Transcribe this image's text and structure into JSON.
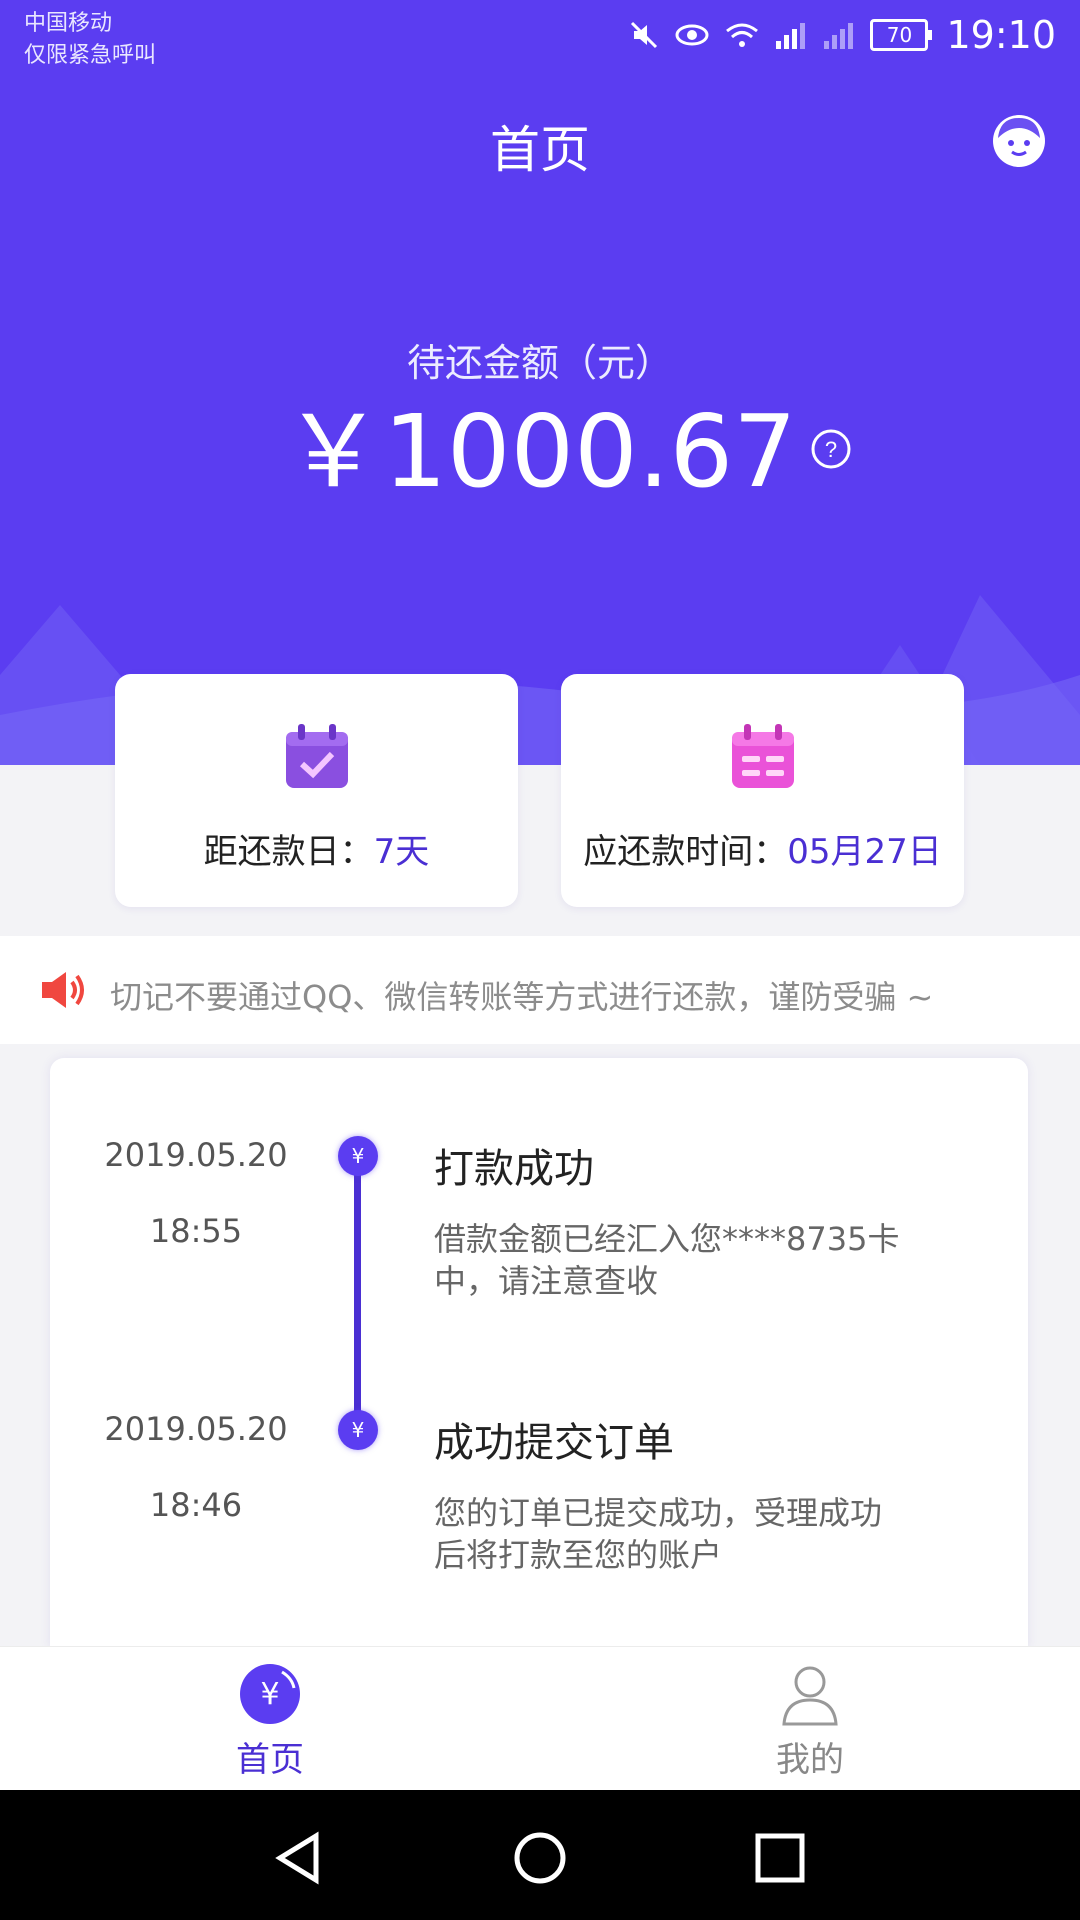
{
  "status_bar": {
    "carrier": "中国移动",
    "carrier_note": "仅限紧急呼叫",
    "battery": "70",
    "time": "19:10"
  },
  "header": {
    "title": "首页"
  },
  "balance": {
    "label": "待还金额（元）",
    "amount": "￥1000.67"
  },
  "cards": [
    {
      "label": "距还款日：",
      "value": "7天",
      "icon": "calendar-check-icon"
    },
    {
      "label": "应还款时间：",
      "value": "05月27日",
      "icon": "calendar-icon"
    }
  ],
  "notice": {
    "text": "切记不要通过QQ、微信转账等方式进行还款，谨防受骗 ~",
    "icon": "speaker-icon"
  },
  "timeline": [
    {
      "date": "2019.05.20",
      "time": "18:55",
      "title": "打款成功",
      "desc": "借款金额已经汇入您****8735卡中，请注意查收",
      "node": "¥"
    },
    {
      "date": "2019.05.20",
      "time": "18:46",
      "title": "成功提交订单",
      "desc": "您的订单已提交成功，受理成功后将打款至您的账户",
      "node": "¥"
    }
  ],
  "tabbar": {
    "home_label": "首页",
    "mine_label": "我的"
  },
  "colors": {
    "primary": "#5b3df1",
    "accent_text": "#4a2fd3"
  }
}
